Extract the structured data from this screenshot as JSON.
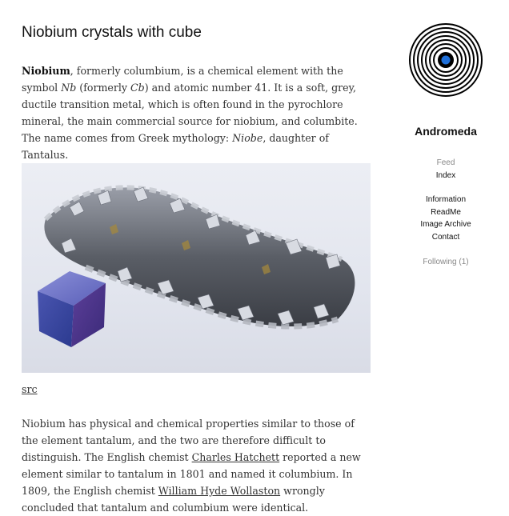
{
  "post": {
    "title": "Niobium crystals with cube",
    "intro": {
      "bold": "Niobium",
      "t1": ", formerly columbium, is a chemical element with the symbol ",
      "sym": "Nb",
      "t2": " (formerly ",
      "sym_old": "Cb",
      "t3": ") and atomic number 41. It is a soft, grey, ductile transition metal, which is often found in the pyrochlore mineral, the main commercial source for niobium, and columbite. The name comes from Greek mythology: ",
      "myth": "Niobe",
      "t4": ", daughter of Tantalus."
    },
    "src_label": "src",
    "body": {
      "t1": "Niobium has physical and chemical properties similar to those of the element tantalum, and the two are therefore difficult to distinguish. The English chemist ",
      "link1": "Charles Hatchett",
      "t2": " reported a new element similar to tantalum in 1801 and named it columbium. In 1809, the English chemist ",
      "link2": "William Hyde Wollaston",
      "t3": " wrongly concluded that tantalum and columbium were identical."
    }
  },
  "sidebar": {
    "blog_name": "Andromeda",
    "links_group1": [
      "Feed",
      "Index"
    ],
    "links_group2": [
      "Information",
      "ReadMe",
      "Image Archive",
      "Contact"
    ],
    "following": "Following (1)"
  },
  "colors": {
    "text": "#333333",
    "muted": "#888888",
    "logo_dot": "#1e6fd9"
  }
}
